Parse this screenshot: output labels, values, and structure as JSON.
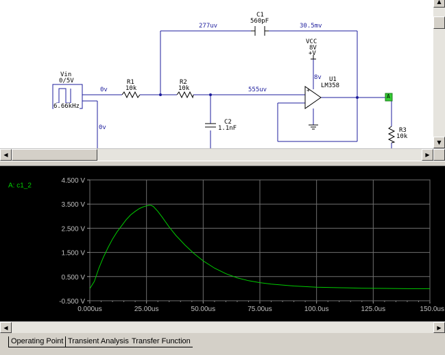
{
  "schematic": {
    "source": {
      "name": "Vin",
      "value": "0/5V",
      "freq": "6.66kHz"
    },
    "components": [
      {
        "name": "R1",
        "value": "10k"
      },
      {
        "name": "R2",
        "value": "10k"
      },
      {
        "name": "C1",
        "value": "560pF"
      },
      {
        "name": "C2",
        "value": "1.1nF"
      },
      {
        "name": "U1",
        "value": "LM358"
      },
      {
        "name": "R3",
        "value": "10k"
      }
    ],
    "vcc": {
      "name": "VCC",
      "value": "8V",
      "symbol": "+V"
    },
    "wire_labels": {
      "node_c1_left": "277uv",
      "node_c1_right": "30.5mv",
      "vin_out": "0v",
      "vin_bottom": "0v",
      "node_r2_out": "555uv",
      "vcc_node": "8v"
    },
    "probe_marker": "A"
  },
  "plot": {
    "trace_label": "A: c1_2",
    "trace_color": "#00cc00"
  },
  "chart_data": {
    "type": "line",
    "title": "",
    "xlabel": "",
    "ylabel": "",
    "x_unit": "us",
    "y_unit": "V",
    "xlim": [
      0,
      150
    ],
    "ylim": [
      -0.5,
      4.5
    ],
    "grid": true,
    "x_ticks": [
      "0.000us",
      "25.00us",
      "50.00us",
      "75.00us",
      "100.0us",
      "125.0us",
      "150.0us"
    ],
    "y_ticks": [
      "4.500 V",
      "3.500 V",
      "2.500 V",
      "1.500 V",
      "0.500 V",
      "-0.500 V"
    ],
    "series": [
      {
        "name": "A: c1_2",
        "x": [
          0,
          2,
          4,
          6,
          8,
          10,
          12,
          14,
          16,
          18,
          20,
          22,
          24,
          26,
          27,
          28,
          30,
          32,
          35,
          38,
          42,
          46,
          50,
          55,
          60,
          65,
          70,
          75,
          80,
          90,
          100,
          110,
          120,
          130,
          140,
          150
        ],
        "y": [
          0.0,
          0.3,
          0.85,
          1.3,
          1.7,
          2.05,
          2.35,
          2.6,
          2.85,
          3.05,
          3.2,
          3.32,
          3.4,
          3.45,
          3.45,
          3.4,
          3.2,
          2.95,
          2.55,
          2.2,
          1.8,
          1.45,
          1.15,
          0.85,
          0.62,
          0.45,
          0.33,
          0.25,
          0.19,
          0.11,
          0.06,
          0.04,
          0.02,
          0.01,
          0.0,
          0.0
        ]
      }
    ]
  }
}
